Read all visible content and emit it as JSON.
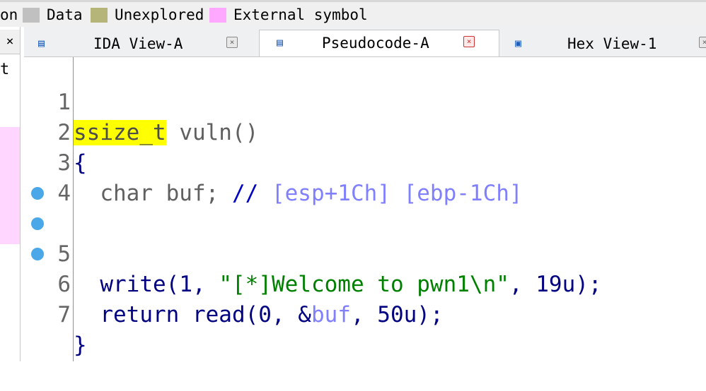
{
  "legend": {
    "prefix": "on",
    "items": [
      {
        "label": "Data",
        "color": "#c0c0c0"
      },
      {
        "label": "Unexplored",
        "color": "#b5b57a"
      },
      {
        "label": "External symbol",
        "color": "#ffa8ff"
      }
    ]
  },
  "left_panel": {
    "close": "×",
    "text": "t"
  },
  "tabs": [
    {
      "label": "IDA View-A",
      "icon": "disassembly-view-icon",
      "close": "×"
    },
    {
      "label": "Pseudocode-A",
      "icon": "pseudocode-view-icon",
      "close": "×"
    },
    {
      "label": "Hex View-1",
      "icon": "hex-view-icon",
      "close": "×"
    }
  ],
  "code": {
    "line1": {
      "num": "1",
      "type": "ssize_t",
      "rest": " vuln()"
    },
    "line2": {
      "num": "2",
      "text": "{"
    },
    "line3": {
      "num": "3",
      "indent": "  ",
      "decl": "char buf; ",
      "comment": "// ",
      "bracket": "[esp+1Ch] [ebp-1Ch]"
    },
    "line4": {
      "num": "4"
    },
    "line5": {
      "num": "5",
      "indent": "  ",
      "fn": "write",
      "p1": "(1, ",
      "str": "\"[*]Welcome to pwn1\\n\"",
      "p2": ", 19u);"
    },
    "line6": {
      "num": "6",
      "indent": "  ",
      "kw": "return ",
      "fn": "read",
      "p1": "(0, &",
      "var": "buf",
      "p2": ", 50u);"
    },
    "line7": {
      "num": "7",
      "text": "}"
    }
  },
  "colors": {
    "highlight": "#ffff00",
    "accent": "#4aa8e8",
    "comment": "#8080ff",
    "string": "#008000"
  }
}
